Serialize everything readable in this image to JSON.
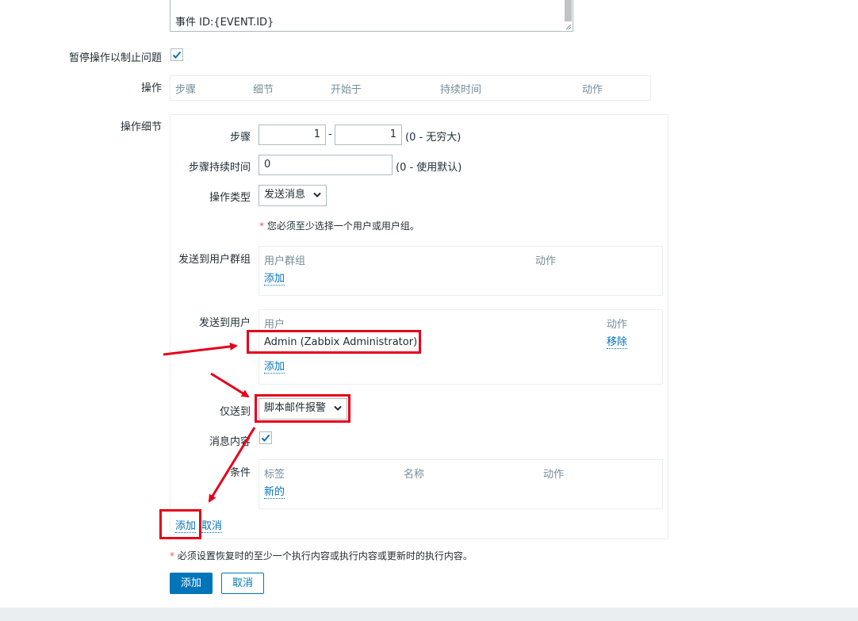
{
  "message_tail": "事件 ID:{EVENT.ID}",
  "pause_label": "暂停操作以制止问题",
  "operations": {
    "label": "操作",
    "headers": [
      "步骤",
      "细节",
      "开始于",
      "持续时间",
      "动作"
    ]
  },
  "details": {
    "label": "操作细节",
    "steps_label": "步骤",
    "step_from": "1",
    "step_sep": "-",
    "step_to": "1",
    "step_hint": "(0 - 无穷大)",
    "duration_label": "步骤持续时间",
    "duration_value": "0",
    "duration_hint": "(0 - 使用默认)",
    "optype_label": "操作类型",
    "optype_value": "发送消息",
    "must_select_star": "*",
    "must_select": "您必须至少选择一个用户或用户组。",
    "usergroups_label": "发送到用户群组",
    "usergroups_headers": [
      "用户群组",
      "动作"
    ],
    "usergroups_add": "添加",
    "users_label": "发送到用户",
    "users_headers": [
      "用户",
      "动作"
    ],
    "users_row_name": "Admin (Zabbix Administrator)",
    "users_row_action": "移除",
    "users_add": "添加",
    "sendonly_label": "仅送到",
    "sendonly_value": "脚本邮件报警",
    "msgcontent_label": "消息内容",
    "conditions_label": "条件",
    "conditions_headers": [
      "标签",
      "名称",
      "动作"
    ],
    "conditions_new": "新的",
    "add_link": "添加",
    "cancel_link": "取消"
  },
  "recovery_note_star": "*",
  "recovery_note": "必须设置恢复时的至少一个执行内容或执行内容或更新时的执行内容。",
  "buttons": {
    "add": "添加",
    "cancel": "取消"
  },
  "colors": {
    "accent": "#0275b8",
    "annotation": "#e4001b"
  }
}
